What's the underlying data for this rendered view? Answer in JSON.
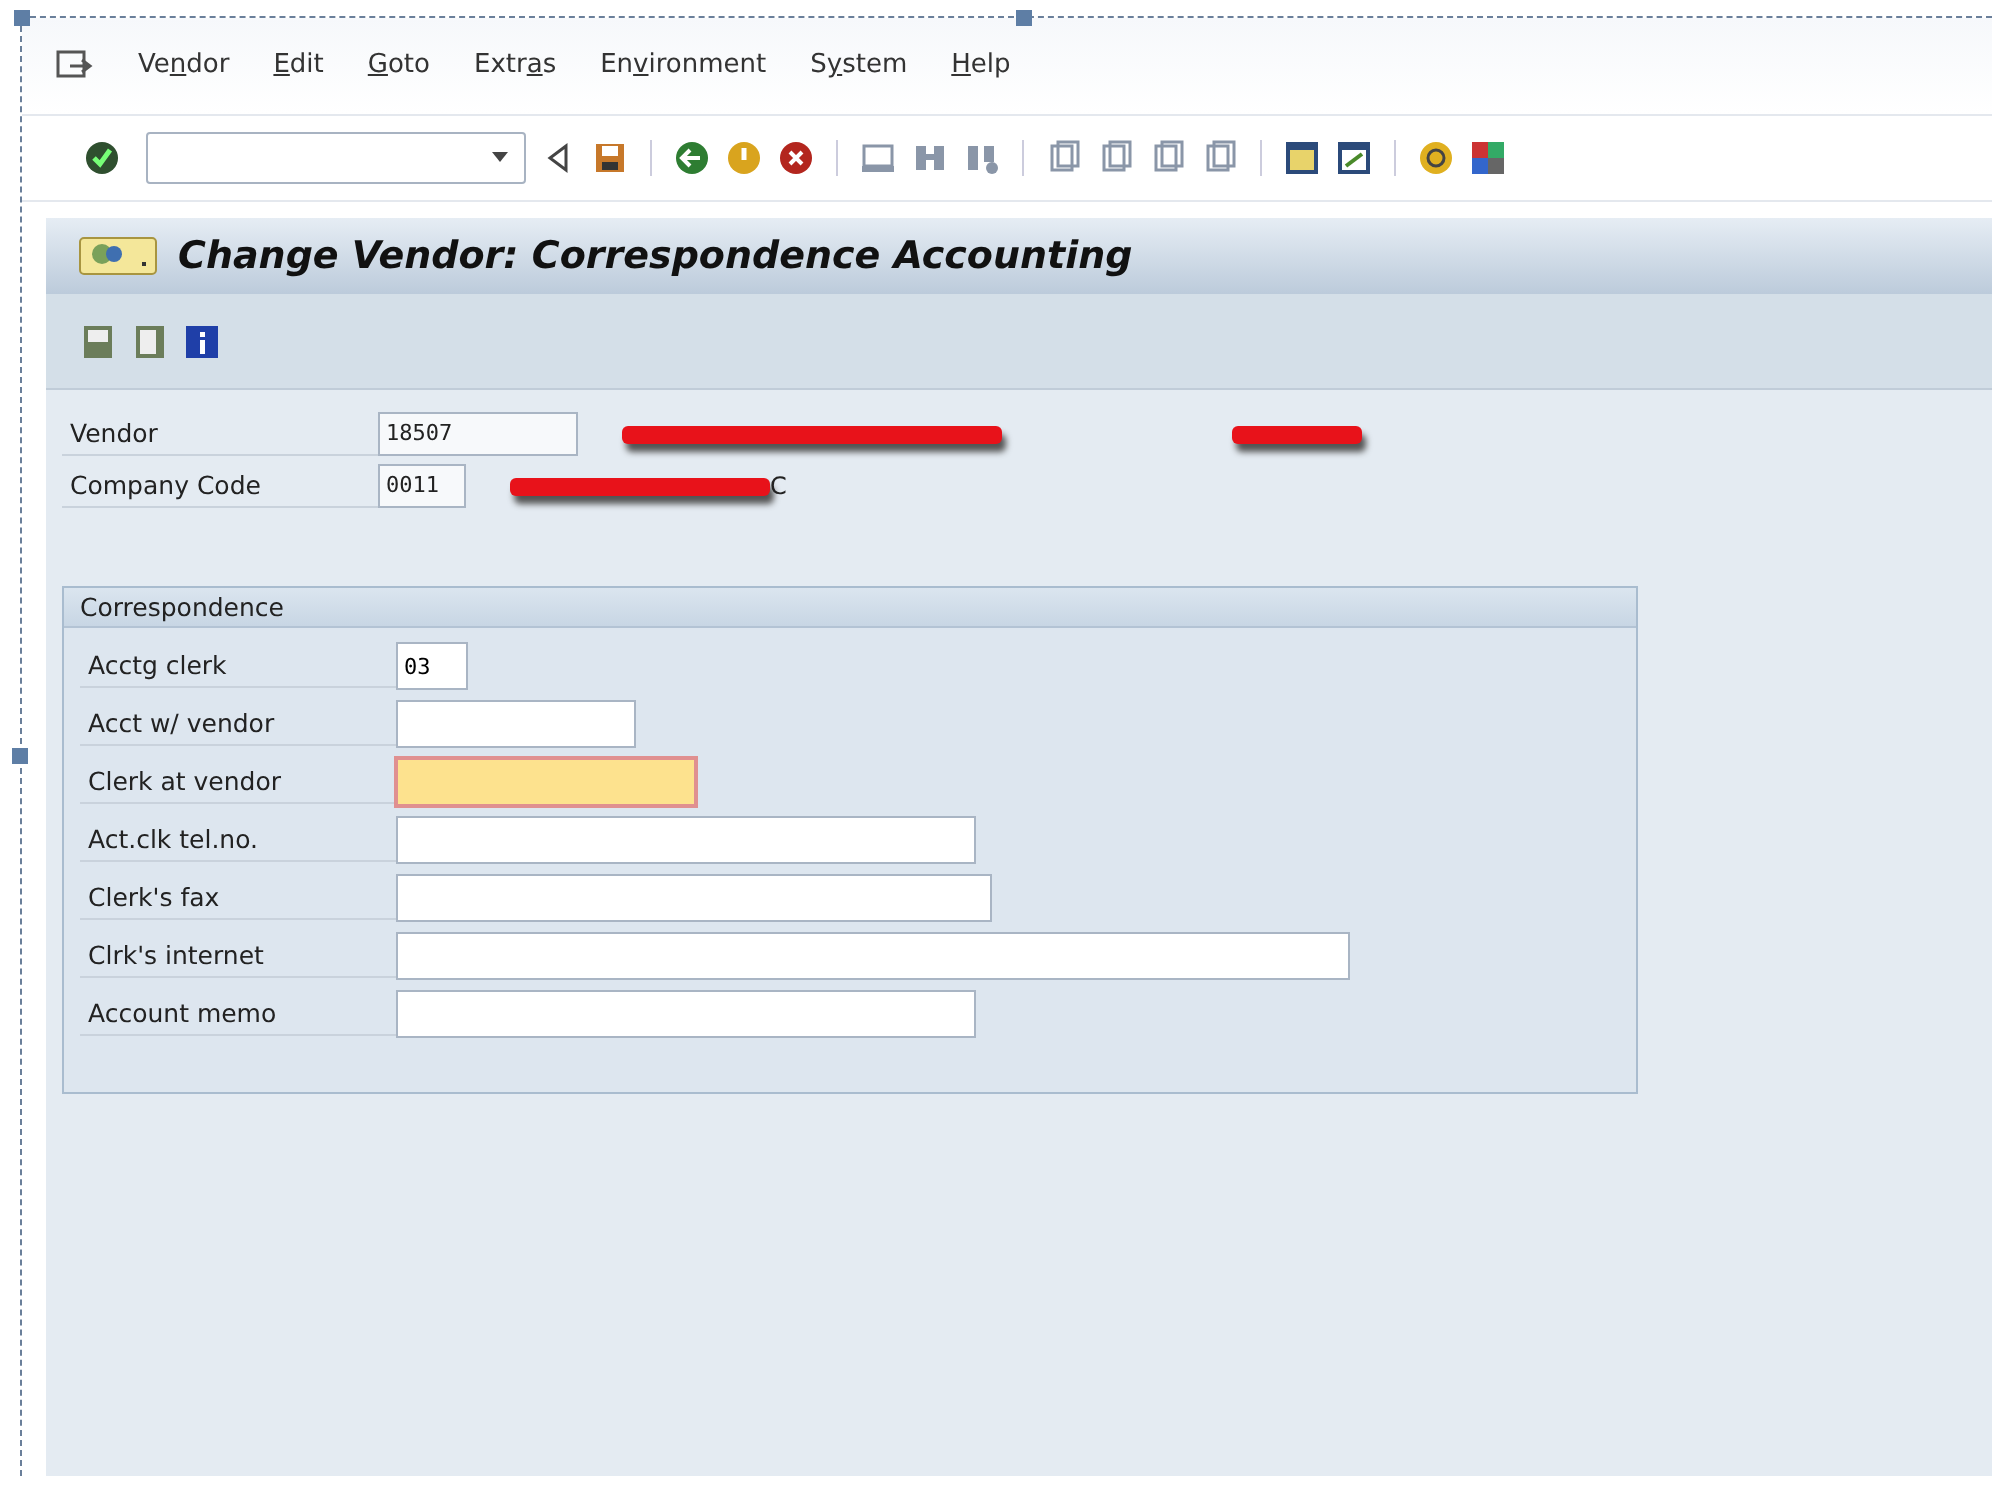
{
  "menu": [
    {
      "before": "Ve",
      "key": "n",
      "after": "dor"
    },
    {
      "key": "E",
      "after": "dit"
    },
    {
      "key": "G",
      "after": "oto"
    },
    {
      "before": "Extr",
      "key": "a",
      "after": "s"
    },
    {
      "before": "En",
      "key": "v",
      "after": "ironment"
    },
    {
      "before": "S",
      "key": "y",
      "after": "stem"
    },
    {
      "key": "H",
      "after": "elp"
    }
  ],
  "title": "Change Vendor: Correspondence Accounting",
  "header_fields": [
    {
      "label": "Vendor",
      "value": "18507"
    },
    {
      "label": "Company Code",
      "value": "0011",
      "redacted_tail": "C"
    }
  ],
  "group": {
    "title": "Correspondence",
    "fields": [
      {
        "label": "Acctg clerk",
        "value": "03",
        "focused": false
      },
      {
        "label": "Acct w/ vendor",
        "focused": false
      },
      {
        "label": "Clerk at vendor",
        "focused": true
      },
      {
        "label": "Act.clk tel.no.",
        "focused": false
      },
      {
        "label": "Clerk's fax",
        "focused": false
      },
      {
        "label": "Clrk's internet",
        "focused": false
      },
      {
        "label": "Account memo",
        "focused": false
      }
    ]
  }
}
